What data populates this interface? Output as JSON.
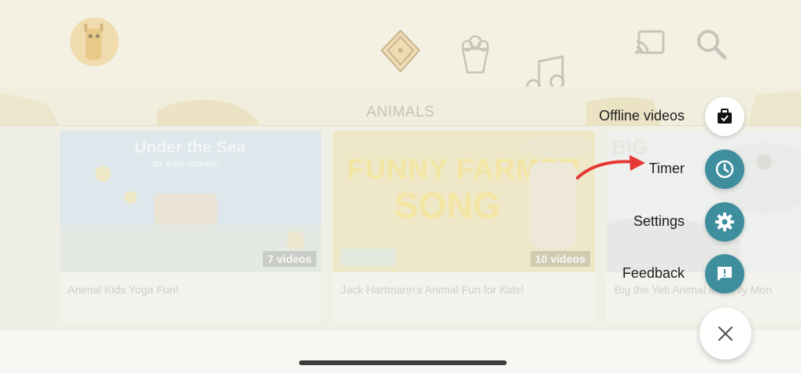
{
  "section": {
    "title": "ANIMALS"
  },
  "cards": [
    {
      "thumb_title": "Under the Sea",
      "thumb_subtitle": "BY BARI KOR4AL",
      "badge": "7 videos",
      "title": "Animal Kids Yoga Fun!"
    },
    {
      "thumb_title_line1": "FUNNY FARMER",
      "thumb_title_line2": "SONG",
      "badge": "10 videos",
      "title": "Jack Hartmann's Animal Fun for Kids!"
    },
    {
      "thumb_title": "BIG",
      "title": "Big the Yeti Animal Monthly Mon"
    }
  ],
  "menu": {
    "offline_label": "Offline videos",
    "timer_label": "Timer",
    "settings_label": "Settings",
    "feedback_label": "Feedback"
  },
  "colors": {
    "accent": "#3e8e9e",
    "arrow": "#e53935"
  }
}
